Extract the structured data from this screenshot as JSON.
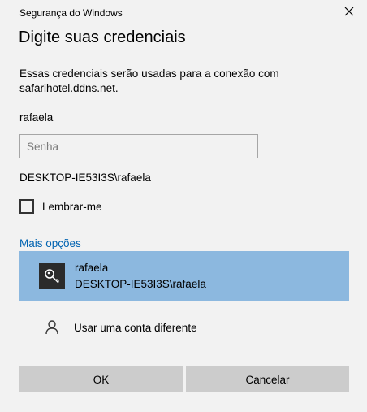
{
  "window": {
    "title": "Segurança do Windows",
    "close_icon": "close-icon"
  },
  "dialog": {
    "heading": "Digite suas credenciais",
    "description": "Essas credenciais serão usadas para a conexão com safarihotel.ddns.net.",
    "username": "rafaela",
    "password": {
      "value": "",
      "placeholder": "Senha"
    },
    "domain_user": "DESKTOP-IE53I3S\\rafaela",
    "remember": {
      "label": "Lembrar-me",
      "checked": false
    },
    "more_options": "Mais opções",
    "accounts": [
      {
        "icon": "key-icon",
        "name": "rafaela",
        "domain": "DESKTOP-IE53I3S\\rafaela",
        "selected": true
      }
    ],
    "other_account": {
      "icon": "person-icon",
      "label": "Usar uma conta diferente"
    },
    "ok_label": "OK",
    "cancel_label": "Cancelar"
  },
  "colors": {
    "background": "#f2f2f2",
    "selected": "#8cb8df",
    "link": "#0063b1",
    "button": "#cccccc"
  }
}
